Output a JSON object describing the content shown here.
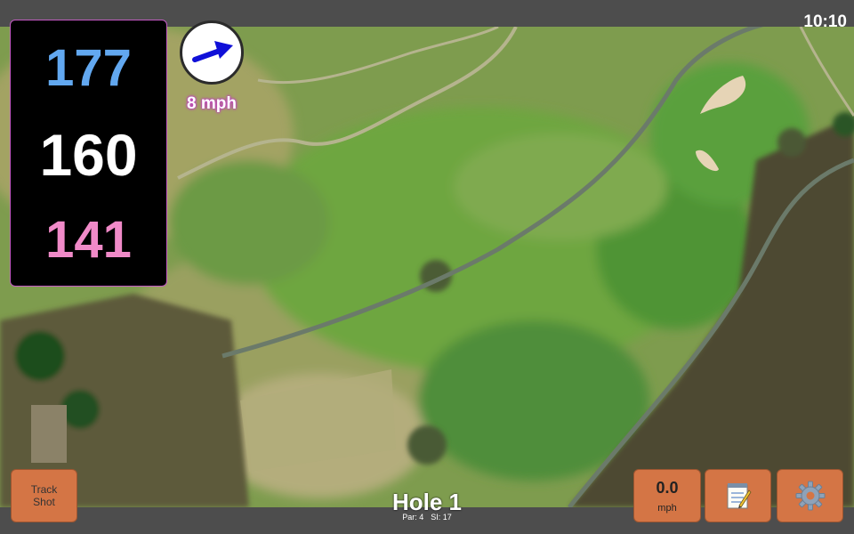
{
  "status": {
    "time": "10:10"
  },
  "distances": {
    "back": "177",
    "middle": "160",
    "front": "141"
  },
  "wind": {
    "speed_label": "8 mph",
    "arrow_icon": "arrow-right-icon"
  },
  "buttons": {
    "track_shot_line1": "Track",
    "track_shot_line2": "Shot",
    "speed_value": "0.0",
    "speed_unit": "mph",
    "notes_icon": "notepad-icon",
    "settings_icon": "gear-icon"
  },
  "hole": {
    "title": "Hole 1",
    "par": "Par: 4",
    "si": "SI: 17"
  },
  "colors": {
    "back": "#62a8f0",
    "middle": "#ffffff",
    "front": "#f08ac8",
    "button": "#d47545",
    "accent_border": "#c55ac5"
  }
}
